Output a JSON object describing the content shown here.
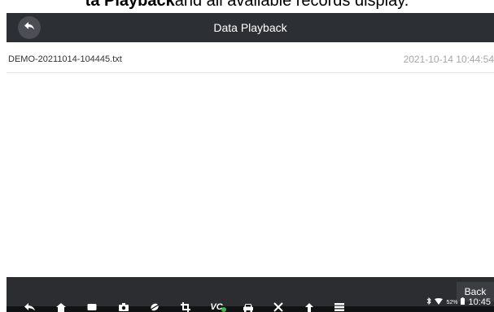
{
  "caption": {
    "bold": "ta Playback",
    "rest": " and all available records display."
  },
  "header": {
    "title": "Data Playback",
    "back_icon": "back-arrow-icon"
  },
  "records": [
    {
      "name": "DEMO-20211014-104445.txt",
      "date": "2021-10-14 10:44:54"
    }
  ],
  "footer": {
    "back_label": "Back"
  },
  "navbar": {
    "icons": [
      "back-icon",
      "home-icon",
      "recents-icon",
      "camera-icon",
      "browser-icon",
      "screenshot-icon",
      "vci-icon",
      "car-icon",
      "tools-icon",
      "upload-icon",
      "menu-icon"
    ],
    "vci_label": "VC",
    "status": {
      "battery_pct": "52%",
      "time": "10:45"
    }
  },
  "colors": {
    "titlebar": "#2c2f33",
    "content_bg": "#ffffff",
    "bottombar": "#2b2d31",
    "navbar": "#111214",
    "date_text": "#a6a6a6",
    "vci_status": "#3ab54a"
  }
}
